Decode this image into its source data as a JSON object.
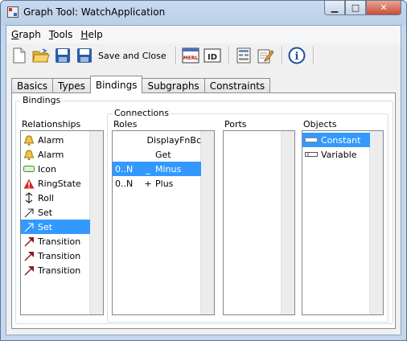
{
  "window": {
    "title": "Graph Tool: WatchApplication",
    "controls": [
      "minimize",
      "maximize",
      "close"
    ]
  },
  "menu": [
    {
      "label": "Graph",
      "underline": "G",
      "rest": "raph"
    },
    {
      "label": "Tools",
      "underline": "T",
      "rest": "ools"
    },
    {
      "label": "Help",
      "underline": "H",
      "rest": "elp"
    }
  ],
  "toolbar": {
    "save_close_label": "Save and Close",
    "icons": [
      "new-doc-icon",
      "open-folder-icon",
      "save-icon",
      "save-close-icon",
      "merl-icon",
      "id-icon",
      "layout-icon",
      "edit-icon",
      "info-icon"
    ],
    "merl_text": "MERL",
    "id_text": "ID",
    "info_text": "i"
  },
  "tabs": [
    {
      "label": "Basics",
      "active": false
    },
    {
      "label": "Types",
      "active": false
    },
    {
      "label": "Bindings",
      "active": true
    },
    {
      "label": "Subgraphs",
      "active": false
    },
    {
      "label": "Constraints",
      "active": false
    }
  ],
  "bindings": {
    "group_label": "Bindings",
    "relationships": {
      "header": "Relationships",
      "items": [
        {
          "label": "Alarm",
          "icon": "bell-icon",
          "selected": false
        },
        {
          "label": "Alarm",
          "icon": "bell-icon",
          "selected": false
        },
        {
          "label": "Icon",
          "icon": "icon-shape-icon",
          "selected": false
        },
        {
          "label": "RingState",
          "icon": "warning-icon",
          "selected": false
        },
        {
          "label": "Roll",
          "icon": "updown-arrow-icon",
          "selected": false
        },
        {
          "label": "Set",
          "icon": "set-arrow-icon",
          "selected": false
        },
        {
          "label": "Set",
          "icon": "set-arrow-icon",
          "selected": true
        },
        {
          "label": "Transition",
          "icon": "transition-arrow-icon",
          "selected": false
        },
        {
          "label": "Transition",
          "icon": "transition-arrow-icon",
          "selected": false
        },
        {
          "label": "Transition",
          "icon": "transition-arrow-icon",
          "selected": false
        }
      ]
    },
    "connections": {
      "group_label": "Connections",
      "roles": {
        "header": "Roles",
        "items": [
          {
            "card": "",
            "sign": "",
            "name": "DisplayFnBc",
            "selected": false
          },
          {
            "card": "",
            "sign": "",
            "name": "Get",
            "selected": false
          },
          {
            "card": "0..N",
            "sign": "_",
            "name": "Minus",
            "selected": true
          },
          {
            "card": "0..N",
            "sign": "+",
            "name": "Plus",
            "selected": false
          }
        ]
      },
      "ports": {
        "header": "Ports",
        "items": []
      },
      "objects": {
        "header": "Objects",
        "items": [
          {
            "label": "Constant",
            "icon": "constant-icon",
            "selected": true
          },
          {
            "label": "Variable",
            "icon": "variable-icon",
            "selected": false
          }
        ]
      }
    }
  },
  "colors": {
    "selection": "#3399ff",
    "titlebar": "#b9cfe8"
  }
}
